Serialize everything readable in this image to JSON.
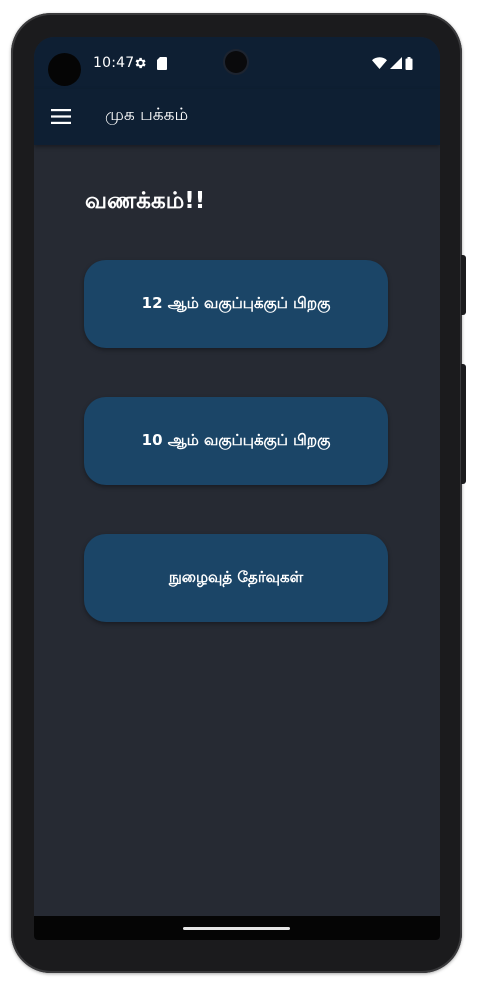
{
  "status_bar": {
    "time": "10:47",
    "icons": [
      "settings-icon",
      "sd-card-icon",
      "wifi-icon",
      "signal-icon",
      "battery-icon"
    ]
  },
  "app_bar": {
    "menu_icon": "hamburger-menu-icon",
    "title": "முக பக்கம்"
  },
  "main": {
    "greeting": "வணக்கம்!!",
    "buttons": [
      {
        "label": "12 ஆம் வகுப்புக்குப் பிறகு"
      },
      {
        "label": "10 ஆம் வகுப்புக்குப் பிறகு"
      },
      {
        "label": "நுழைவுத் தேர்வுகள்"
      }
    ]
  },
  "colors": {
    "background": "#262a33",
    "app_bar": "#0e1f33",
    "button": "#1b4567",
    "text": "#ffffff"
  }
}
